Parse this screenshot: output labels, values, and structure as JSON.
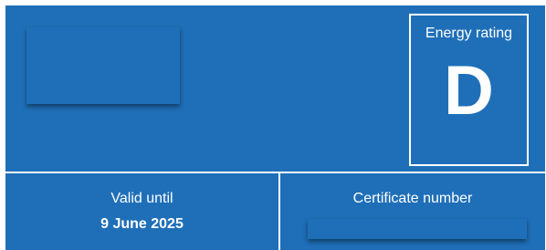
{
  "rating": {
    "title": "Energy rating",
    "letter": "D"
  },
  "valid_until": {
    "label": "Valid until",
    "value": "9 June 2025"
  },
  "certificate": {
    "label": "Certificate number"
  }
}
